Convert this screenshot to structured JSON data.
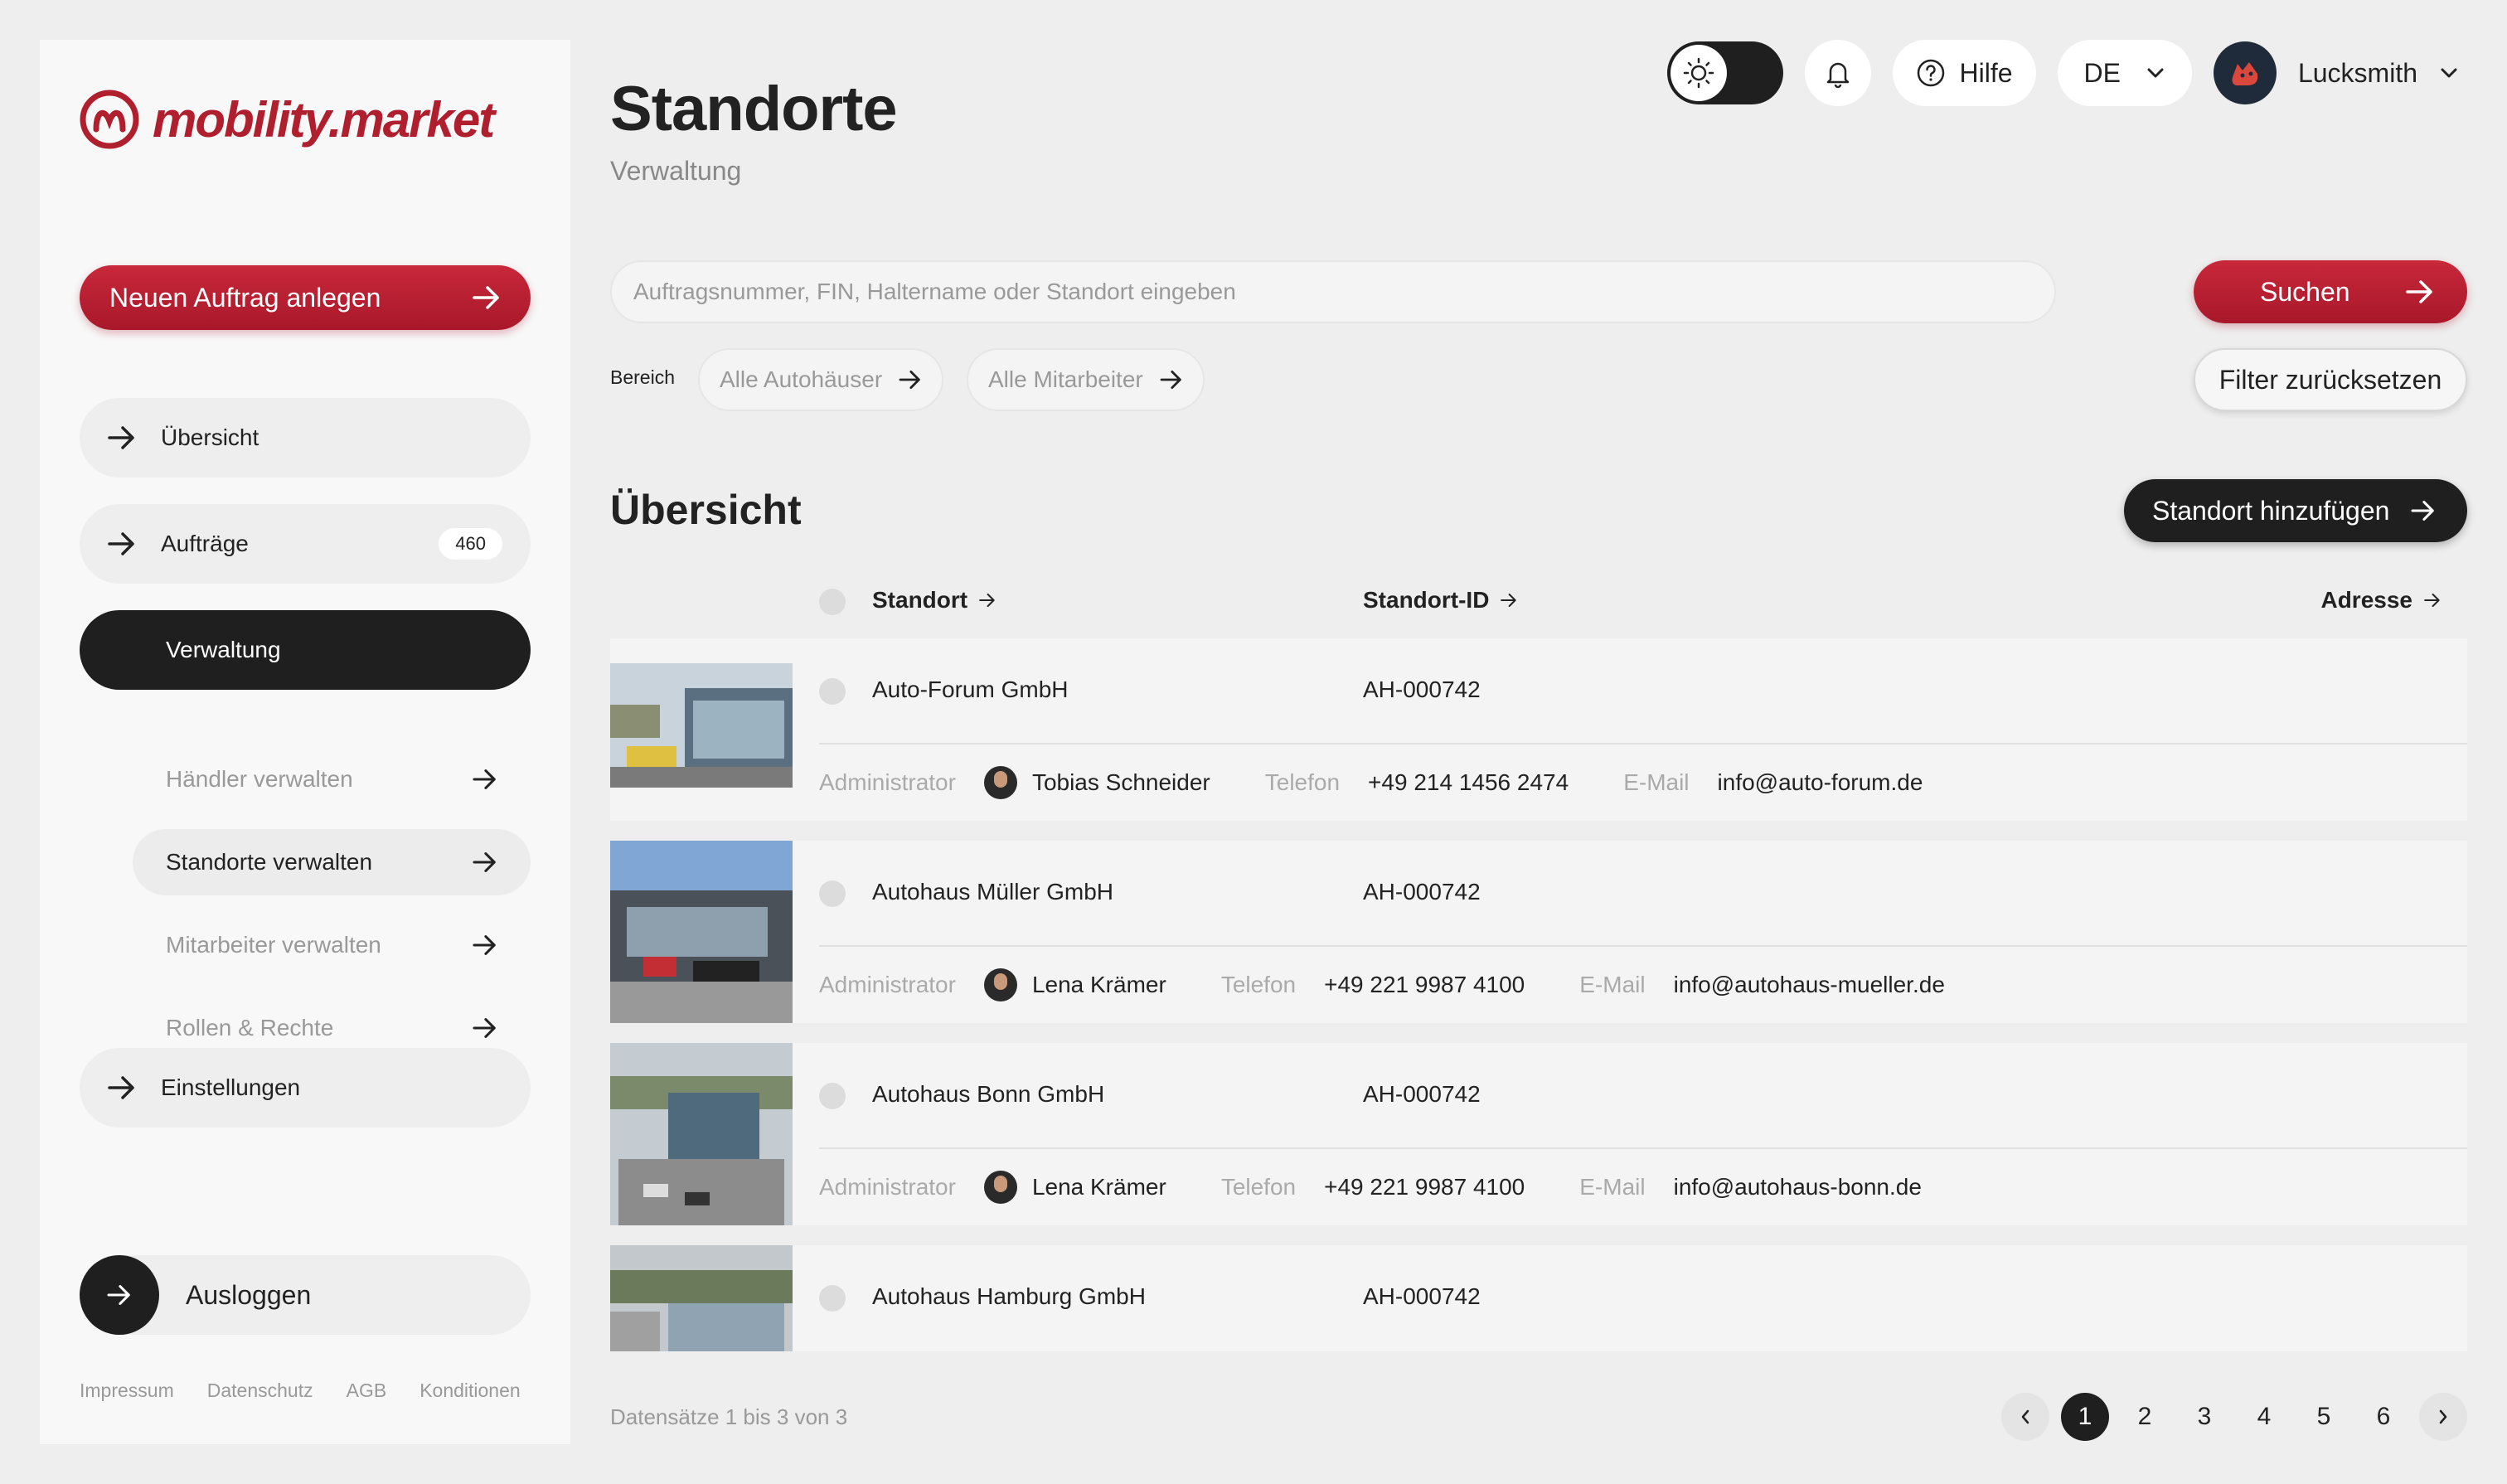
{
  "brand": {
    "name": "mobility.market",
    "accent": "#b01f2e",
    "dark": "#1f1f1f"
  },
  "sidebar": {
    "new_order": "Neuen Auftrag anlegen",
    "items": [
      {
        "label": "Übersicht"
      },
      {
        "label": "Aufträge",
        "badge": "460"
      },
      {
        "label": "Verwaltung"
      }
    ],
    "sub_items": [
      {
        "label": "Händler verwalten"
      },
      {
        "label": "Standorte verwalten"
      },
      {
        "label": "Mitarbeiter verwalten"
      },
      {
        "label": "Rollen & Rechte"
      }
    ],
    "settings": "Einstellungen",
    "logout": "Ausloggen",
    "footer_links": [
      "Impressum",
      "Datenschutz",
      "AGB",
      "Konditionen"
    ]
  },
  "header": {
    "title": "Standorte",
    "subtitle": "Verwaltung",
    "help": "Hilfe",
    "language": "DE",
    "user": "Lucksmith"
  },
  "search": {
    "placeholder": "Auftragsnummer, FIN, Haltername oder Standort eingeben",
    "button": "Suchen",
    "range_label": "Bereich",
    "filter_dealers": "Alle Autohäuser",
    "filter_staff": "Alle Mitarbeiter",
    "reset": "Filter zurücksetzen"
  },
  "overview": {
    "title": "Übersicht",
    "add_button": "Standort hinzufügen",
    "columns": [
      "Standort",
      "Standort-ID",
      "Adresse"
    ],
    "labels": {
      "admin": "Administrator",
      "phone": "Telefon",
      "email": "E-Mail"
    },
    "rows": [
      {
        "name": "Auto-Forum GmbH",
        "id": "AH-000742",
        "admin": "Tobias Schneider",
        "phone": "+49 214 1456 2474",
        "email": "info@auto-forum.de"
      },
      {
        "name": "Autohaus Müller GmbH",
        "id": "AH-000742",
        "admin": "Lena Krämer",
        "phone": "+49 221 9987 4100",
        "email": "info@autohaus-mueller.de"
      },
      {
        "name": "Autohaus Bonn GmbH",
        "id": "AH-000742",
        "admin": "Lena Krämer",
        "phone": "+49 221 9987 4100",
        "email": "info@autohaus-bonn.de"
      },
      {
        "name": "Autohaus Hamburg GmbH",
        "id": "AH-000742"
      }
    ]
  },
  "pagination": {
    "info": "Datensätze 1 bis 3 von 3",
    "pages": [
      "1",
      "2",
      "3",
      "4",
      "5",
      "6"
    ],
    "current": "1"
  }
}
